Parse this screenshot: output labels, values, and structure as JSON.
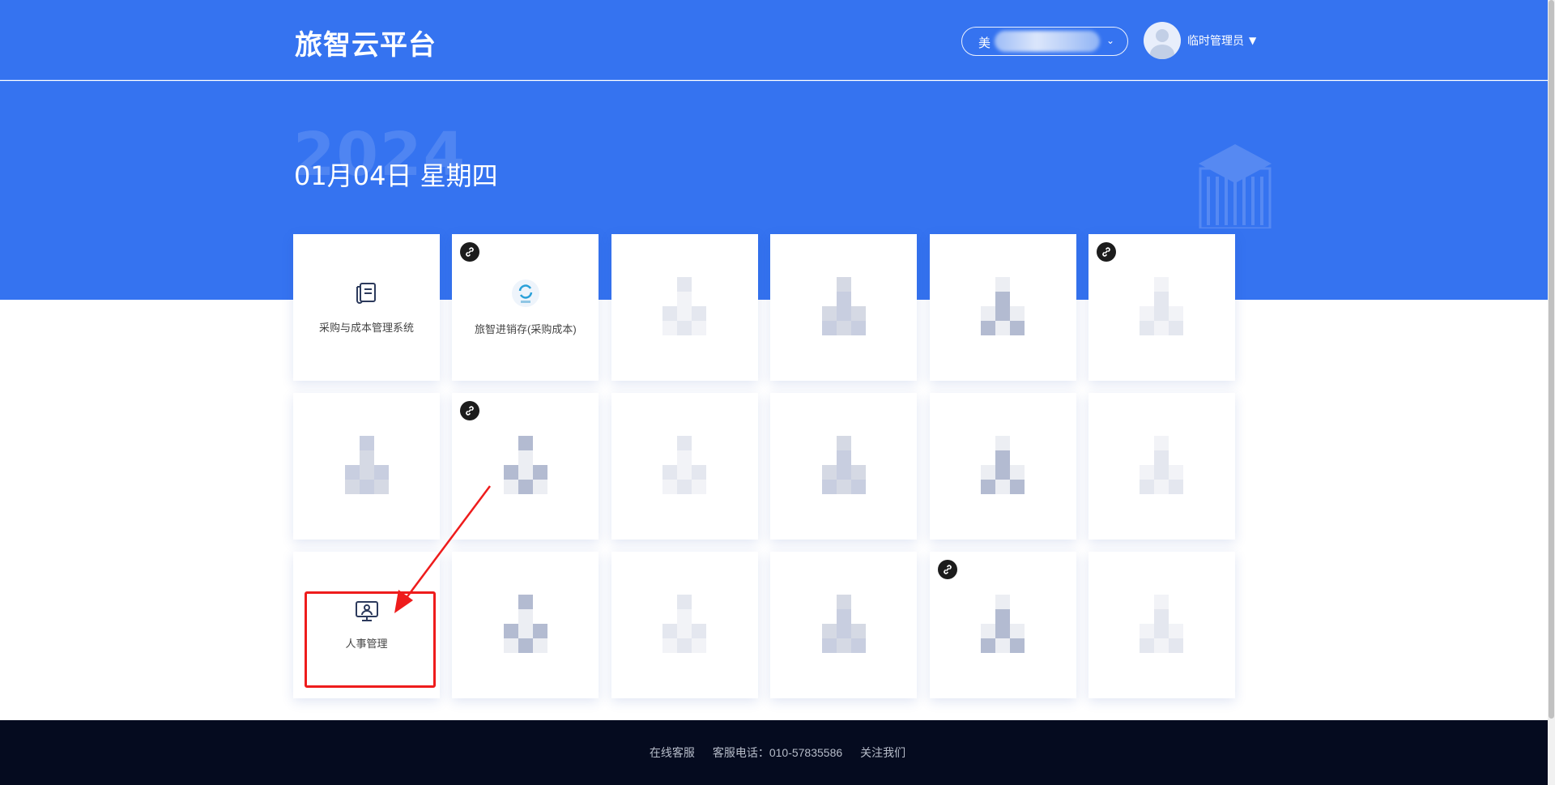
{
  "header": {
    "brand": "旅智云平台",
    "store_select_prefix": "美",
    "store_select_caret": "⌄",
    "user_name": "临时管理员",
    "user_caret": "▼"
  },
  "hero": {
    "year_watermark": "2024",
    "date_text": "01月04日 星期四"
  },
  "tiles": [
    {
      "label": "采购与成本管理系统",
      "icon": "ledger-icon",
      "mini_program": false
    },
    {
      "label": "旅智进销存(采购成本)",
      "icon": "lvzhi-logo-icon",
      "mini_program": true
    },
    {
      "label": "",
      "icon": "pixelated-icon",
      "mini_program": false
    },
    {
      "label": "",
      "icon": "pixelated-icon",
      "mini_program": false
    },
    {
      "label": "",
      "icon": "pixelated-icon",
      "mini_program": false
    },
    {
      "label": "",
      "icon": "pixelated-icon",
      "mini_program": true
    },
    {
      "label": "",
      "icon": "pixelated-icon",
      "mini_program": false
    },
    {
      "label": "",
      "icon": "pixelated-icon",
      "mini_program": true
    },
    {
      "label": "",
      "icon": "pixelated-icon",
      "mini_program": false
    },
    {
      "label": "",
      "icon": "pixelated-icon",
      "mini_program": false
    },
    {
      "label": "",
      "icon": "pixelated-icon",
      "mini_program": false
    },
    {
      "label": "",
      "icon": "pixelated-icon",
      "mini_program": false
    },
    {
      "label": "人事管理",
      "icon": "monitor-user-icon",
      "mini_program": false
    },
    {
      "label": "",
      "icon": "pixelated-icon",
      "mini_program": false
    },
    {
      "label": "",
      "icon": "pixelated-icon",
      "mini_program": false
    },
    {
      "label": "",
      "icon": "pixelated-icon",
      "mini_program": false
    },
    {
      "label": "",
      "icon": "pixelated-icon",
      "mini_program": true
    },
    {
      "label": "",
      "icon": "pixelated-icon",
      "mini_program": false
    }
  ],
  "footer": {
    "online_service": "在线客服",
    "hotline": "客服电话：010-57835586",
    "follow_us": "关注我们"
  },
  "colors": {
    "primary_blue": "#3573f0",
    "footer_bg": "#050b1f",
    "highlight_red": "#ee1c1c"
  }
}
